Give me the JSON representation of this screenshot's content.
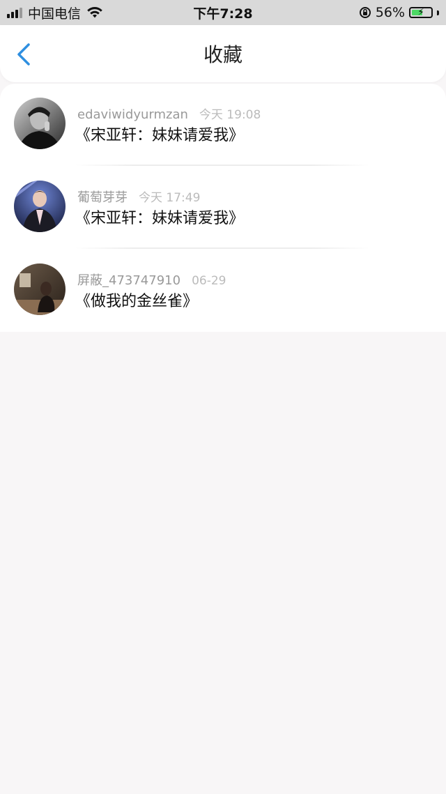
{
  "status_bar": {
    "carrier": "中国电信",
    "time": "下午7:28",
    "battery_percent": "56%",
    "battery_level": 0.56
  },
  "header": {
    "title": "收藏"
  },
  "favorites": [
    {
      "user": "edaviwidyurmzan",
      "time": "今天 19:08",
      "title": "《宋亚轩：妹妹请爱我》"
    },
    {
      "user": "葡萄芽芽",
      "time": "今天 17:49",
      "title": "《宋亚轩：妹妹请爱我》"
    },
    {
      "user": "屏蔽_473747910",
      "time": "06-29",
      "title": "《做我的金丝雀》"
    }
  ]
}
